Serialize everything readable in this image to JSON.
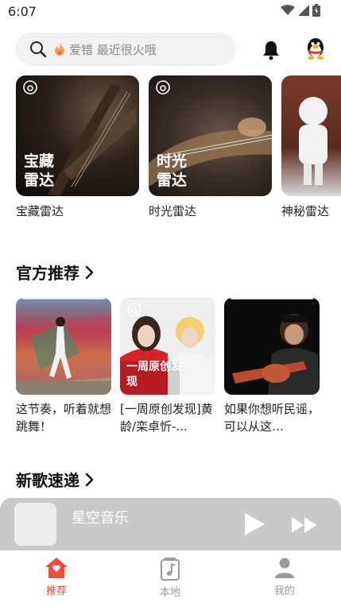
{
  "status": {
    "time": "6:07"
  },
  "search": {
    "placeholder": "爱错 最近很火哦",
    "hot_icon": "fire-icon"
  },
  "header": {
    "bell_icon": "bell-icon",
    "avatar_icon": "qq-penguin-icon"
  },
  "radar": {
    "items": [
      {
        "overlay": "宝藏雷达",
        "caption": "宝藏雷达"
      },
      {
        "overlay": "时光雷达",
        "caption": "时光雷达"
      },
      {
        "overlay": "",
        "caption": "神秘雷达"
      }
    ]
  },
  "official": {
    "title": "官方推荐",
    "items": [
      {
        "overlay": "",
        "caption": "这节奏，听着就想跳舞！"
      },
      {
        "overlay": "一周原创发现",
        "caption": "[一周原创发现]黄龄/栾卓忻-..."
      },
      {
        "overlay": "",
        "caption": "如果你想听民谣，可以从这…"
      }
    ]
  },
  "new_songs": {
    "title": "新歌速递"
  },
  "player": {
    "title": "星空音乐",
    "play_icon": "play-icon",
    "next_icon": "fast-forward-icon"
  },
  "tabs": [
    {
      "label": "推荐",
      "icon": "home-icon",
      "active": true
    },
    {
      "label": "本地",
      "icon": "music-file-icon",
      "active": false
    },
    {
      "label": "我的",
      "icon": "person-icon",
      "active": false
    }
  ],
  "colors": {
    "accent": "#ef4b3f",
    "inactive": "#9a9a9a"
  }
}
